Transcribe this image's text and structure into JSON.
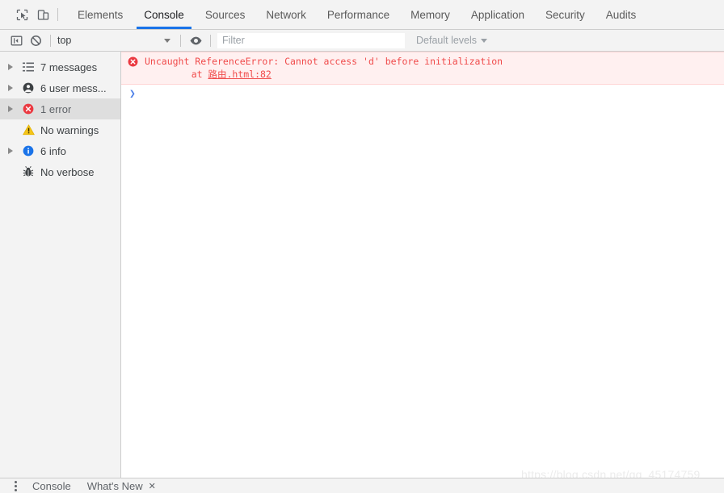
{
  "panel": {
    "left_icons": [
      {
        "name": "inspect-element-icon",
        "title": "Inspect element"
      },
      {
        "name": "device-toolbar-icon",
        "title": "Toggle device toolbar"
      }
    ],
    "tabs": [
      {
        "label": "Elements",
        "active": false
      },
      {
        "label": "Console",
        "active": true
      },
      {
        "label": "Sources",
        "active": false
      },
      {
        "label": "Network",
        "active": false
      },
      {
        "label": "Performance",
        "active": false
      },
      {
        "label": "Memory",
        "active": false
      },
      {
        "label": "Application",
        "active": false
      },
      {
        "label": "Security",
        "active": false
      },
      {
        "label": "Audits",
        "active": false
      }
    ],
    "active_tab_underline_color": "#1a73e8"
  },
  "console_toolbar": {
    "sidebar_toggle_icon": "sidebar-toggle-icon",
    "clear_console_icon": "clear-console-icon",
    "context_value": "top",
    "eye_icon": "eye-icon",
    "filter_placeholder": "Filter",
    "filter_value": "",
    "levels_label": "Default levels"
  },
  "sidebar": {
    "items": [
      {
        "label": "7 messages",
        "icon": "list-icon",
        "arrow": true,
        "selected": false
      },
      {
        "label": "6 user mess...",
        "icon": "user-icon",
        "arrow": true,
        "selected": false
      },
      {
        "label": "1 error",
        "icon": "error-icon",
        "arrow": true,
        "selected": true
      },
      {
        "label": "No warnings",
        "icon": "warning-icon",
        "arrow": false,
        "selected": false
      },
      {
        "label": "6 info",
        "icon": "info-icon",
        "arrow": true,
        "selected": false
      },
      {
        "label": "No verbose",
        "icon": "bug-icon",
        "arrow": false,
        "selected": false
      }
    ]
  },
  "console": {
    "error": {
      "icon": "error-icon",
      "message": "Uncaught ReferenceError: Cannot access 'd' before initialization",
      "stack_prefix": "    at ",
      "stack_link": "路由.html:82",
      "background": "#fff0f0",
      "text_color": "#f04b4b"
    },
    "prompt_caret": "❯",
    "prompt_value": ""
  },
  "watermark": {
    "text": "https://blog.csdn.net/qq_45174759"
  },
  "drawer": {
    "tabs": [
      {
        "label": "Console",
        "closable": false
      },
      {
        "label": "What's New",
        "closable": true
      }
    ],
    "close_glyph": "✕"
  }
}
